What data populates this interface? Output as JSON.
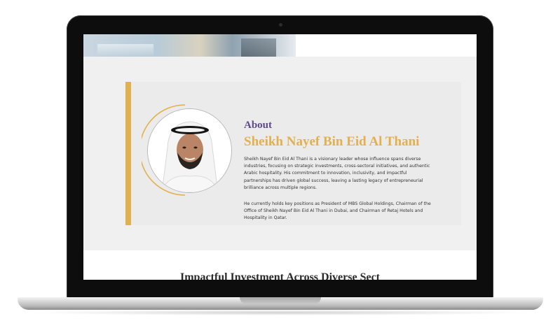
{
  "about": {
    "label": "About",
    "name": "Sheikh Nayef Bin Eid Al Thani",
    "paragraph1": "Sheikh Nayef Bin Eid Al Thani is a visionary leader whose influence spans diverse industries, focusing on strategic investments, cross-sectoral initiatives, and authentic Arabic hospitality. His commitment to innovation, inclusivity, and impactful partnerships has driven global success, leaving a lasting legacy of entrepreneurial brilliance across multiple regions.",
    "paragraph2": "He currently holds key positions as President of MBS Global Holdings, Chairman of the Office of Sheikh Nayef Bin Eid Al Thani in Dubai, and Chairman of Retaj Hotels and Hospitality in Qatar.",
    "portrait_icon": "person-portrait"
  },
  "next_section": {
    "heading_partial": "Impactful Investment Across Diverse Sect"
  },
  "colors": {
    "accent_gold": "#e3b04b",
    "accent_purple": "#5d4a89",
    "section_bg": "#f0f0f0"
  }
}
